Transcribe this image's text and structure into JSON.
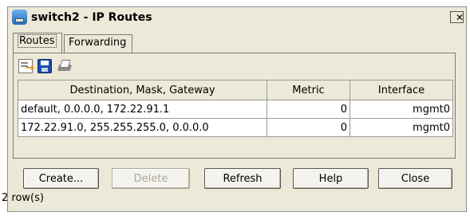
{
  "window": {
    "title": "switch2 - IP Routes",
    "close_glyph": "✕"
  },
  "tabs": [
    {
      "label": "Routes",
      "active": true
    },
    {
      "label": "Forwarding",
      "active": false
    }
  ],
  "toolbar": {
    "icons": [
      "export-icon",
      "save-icon",
      "print-icon"
    ]
  },
  "table": {
    "columns": [
      "Destination, Mask, Gateway",
      "Metric",
      "Interface"
    ],
    "rows": [
      [
        "default, 0.0.0.0, 172.22.91.1",
        "0",
        "mgmt0"
      ],
      [
        "172.22.91.0, 255.255.255.0, 0.0.0.0",
        "0",
        "mgmt0"
      ]
    ]
  },
  "buttons": {
    "create": "Create...",
    "delete": "Delete",
    "refresh": "Refresh",
    "help": "Help",
    "close": "Close"
  },
  "status": "2 row(s)"
}
